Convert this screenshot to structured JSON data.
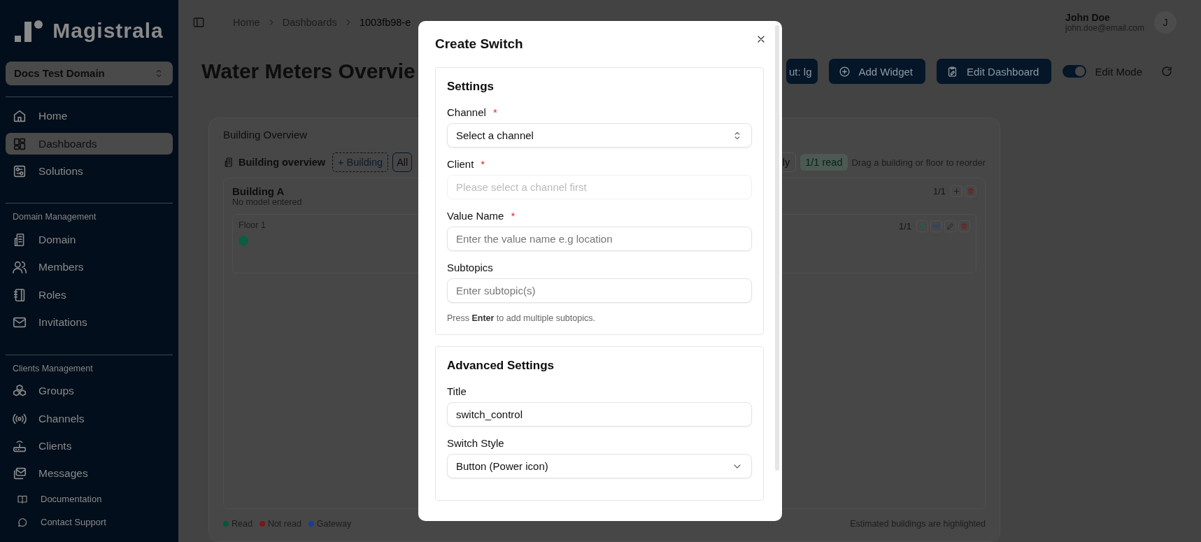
{
  "sidebar": {
    "logo": "Magistrala",
    "domain": "Docs Test Domain",
    "sections": [
      {
        "items": [
          {
            "label": "Home",
            "selected": false
          },
          {
            "label": "Dashboards",
            "selected": true
          },
          {
            "label": "Solutions",
            "selected": false
          }
        ]
      },
      {
        "heading": "Domain Management",
        "items": [
          {
            "label": "Domain",
            "selected": false
          },
          {
            "label": "Members",
            "selected": false
          },
          {
            "label": "Roles",
            "selected": false
          },
          {
            "label": "Invitations",
            "selected": false
          }
        ]
      },
      {
        "heading": "Clients Management",
        "items": [
          {
            "label": "Groups",
            "selected": false
          },
          {
            "label": "Channels",
            "selected": false
          },
          {
            "label": "Clients",
            "selected": false
          },
          {
            "label": "Messages",
            "selected": false
          }
        ]
      }
    ],
    "footer": [
      "Documentation",
      "Contact Support"
    ]
  },
  "header": {
    "breadcrumbs": [
      "Home",
      "Dashboards",
      "1003fb98-e"
    ],
    "user": {
      "name": "John Doe",
      "email": "john.doe@email.com",
      "initial": "J"
    }
  },
  "page": {
    "title": "Water Meters Overvie",
    "actions": [
      "ut: lg",
      "Add Widget",
      "Edit Dashboard"
    ],
    "edit_mode": {
      "label": "Edit Mode",
      "on": true
    }
  },
  "card": {
    "title": "Building Overview",
    "toolbar": {
      "label": "Building overview",
      "add_button": "+ Building",
      "filters": [
        {
          "label": "All",
          "selected": true
        },
        {
          "label": "ly",
          "selected": false
        }
      ],
      "read_badge": "1/1 read",
      "hint": "Drag a building or floor to reorder"
    },
    "buildings": [
      {
        "name": "Building A",
        "model": "No model entered",
        "count": "1/1",
        "floors": [
          {
            "name": "Floor 1",
            "count": "1/1",
            "meters": [
              {
                "color": "#0b5e40"
              }
            ]
          }
        ]
      }
    ],
    "legend": [
      {
        "label": "Read",
        "color": "#07553a"
      },
      {
        "label": "Not read",
        "color": "#7a1717"
      },
      {
        "label": "Gateway",
        "color": "#173f90"
      }
    ],
    "note": "Estimated buildings are highlighted"
  },
  "modal": {
    "title": "Create Switch",
    "sections": [
      {
        "title": "Settings",
        "fields": [
          {
            "kind": "combobox",
            "label": "Channel",
            "marker": "*",
            "value": "Select a channel",
            "disabled": false
          },
          {
            "kind": "input",
            "label": "Client",
            "marker": "*",
            "placeholder": "Please select a channel first",
            "disabled": true
          },
          {
            "kind": "input",
            "label": "Value Name",
            "marker": "*",
            "placeholder": "Enter the value name e.g location",
            "disabled": false
          },
          {
            "kind": "input",
            "label": "Subtopics",
            "placeholder": "Enter subtopic(s)",
            "disabled": false
          }
        ],
        "help": "Press **Enter** to add multiple subtopics."
      },
      {
        "title": "Advanced Settings",
        "fields": [
          {
            "kind": "input",
            "label": "Title",
            "value": "switch_control",
            "disabled": false
          },
          {
            "kind": "select",
            "label": "Switch Style",
            "value": "Button (Power icon)",
            "disabled": false
          }
        ]
      }
    ]
  }
}
